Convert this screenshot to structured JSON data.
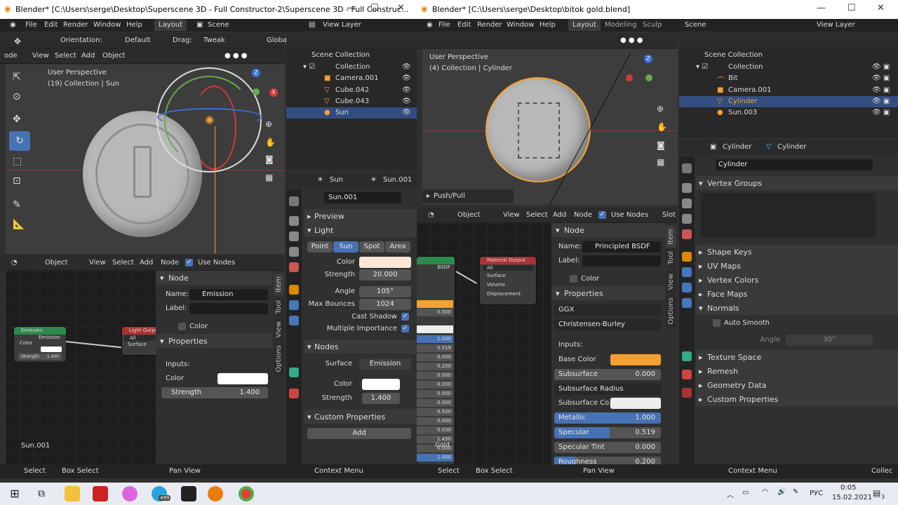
{
  "left": {
    "title": "Blender* [C:\\Users\\serge\\Desktop\\Superscene 3D - Full Constructor-2\\Superscene 3D - Full Construc...",
    "menu": [
      "File",
      "Edit",
      "Render",
      "Window",
      "Help"
    ],
    "workspace": "Layout",
    "scene": "Scene",
    "view_layer": "View Layer",
    "toolbar": {
      "orientation_label": "Orientation:",
      "orientation": "Default",
      "drag_label": "Drag:",
      "drag": "Tweak",
      "transform": "Globa"
    },
    "viewport_menu": [
      "View",
      "Select",
      "Add",
      "Object"
    ],
    "viewport_mode": "ode",
    "viewport_info": [
      "User Perspective",
      "(19) Collection | Sun"
    ],
    "outliner": {
      "root": "Scene Collection",
      "items": [
        {
          "name": "Collection"
        },
        {
          "name": "Camera.001"
        },
        {
          "name": "Cube.042"
        },
        {
          "name": "Cube.043"
        },
        {
          "name": "Sun"
        }
      ]
    },
    "properties": {
      "object_name": "Sun",
      "data_name": "Sun.001",
      "data_field": "Sun.001",
      "preview": "Preview",
      "light": "Light",
      "light_types": [
        "Point",
        "Sun",
        "Spot",
        "Area"
      ],
      "color_label": "Color",
      "strength_label": "Strength",
      "strength": "20.000",
      "angle_label": "Angle",
      "angle": "105°",
      "bounces_label": "Max Bounces",
      "bounces": "1024",
      "cast_shadow": "Cast Shadow",
      "multiple_importance": "Multiple Importance",
      "nodes": "Nodes",
      "surface_label": "Surface",
      "surface": "Emission",
      "ncolor_label": "Color",
      "nstrength_label": "Strength",
      "nstrength": "1.400",
      "custom_props": "Custom Properties",
      "add": "Add"
    },
    "node_editor": {
      "mode": "Object",
      "menu": [
        "View",
        "Select",
        "Add",
        "Node"
      ],
      "use_nodes": "Use Nodes",
      "frame_label": "Sun.001",
      "emission_node": {
        "title": "Emission",
        "out": "Emission",
        "color": "Color",
        "strength": "Strength",
        "strength_val": "1.400"
      },
      "light_output_node": {
        "title": "Light Output",
        "target": "All",
        "surface": "Surface"
      }
    },
    "sidebar": {
      "node": "Node",
      "name_label": "Name:",
      "name": "Emission",
      "label_label": "Label:",
      "color": "Color",
      "properties": "Properties",
      "inputs": "Inputs:",
      "in_color": "Color",
      "in_strength": "Strength",
      "in_strength_val": "1.400",
      "tabs": [
        "Item",
        "Tool",
        "View",
        "Options"
      ]
    },
    "status": [
      "Select",
      "Box Select",
      "Pan View",
      "Context Menu"
    ]
  },
  "right": {
    "title": "Blender* [C:\\Users\\serge\\Desktop\\bitok gold.blend]",
    "menu": [
      "File",
      "Edit",
      "Render",
      "Window",
      "Help"
    ],
    "workspaces": [
      "Layout",
      "Modeling",
      "Sculp"
    ],
    "scene": "Scene",
    "view_layer": "View Layer",
    "viewport_info": [
      "User Perspective",
      "(4) Collection | Cylinder"
    ],
    "operator": "Push/Pull",
    "outliner": {
      "root": "Scene Collection",
      "items": [
        {
          "name": "Collection"
        },
        {
          "name": "Bit"
        },
        {
          "name": "Camera.001"
        },
        {
          "name": "Cylinder"
        },
        {
          "name": "Sun.003"
        }
      ]
    },
    "properties": {
      "object": "Cylinder",
      "mesh": "Cylinder",
      "mesh_field": "Cylinder",
      "sections": [
        "Vertex Groups",
        "Shape Keys",
        "UV Maps",
        "Vertex Colors",
        "Face Maps",
        "Normals"
      ],
      "auto_smooth": "Auto Smooth",
      "angle_label": "Angle",
      "angle": "30°",
      "sections2": [
        "Texture Space",
        "Remesh",
        "Geometry Data",
        "Custom Properties"
      ]
    },
    "node_editor": {
      "mode": "Object",
      "menu": [
        "View",
        "Select",
        "Add",
        "Node"
      ],
      "use_nodes": "Use Nodes",
      "slot": "Slot",
      "material_output": {
        "title": "Material Output",
        "target": "All",
        "surface": "Surface",
        "volume": "Volume",
        "displacement": "Displacement"
      },
      "bsdf_label": "BSDF",
      "slot_values": [
        "0.000",
        "1.000",
        "0.519",
        "0.000",
        "0.200",
        "0.000",
        "0.000",
        "0.000",
        "0.000",
        "0.500",
        "0.000",
        "0.030",
        "1.450",
        "0.000",
        "1.000"
      ],
      "frame_label": "Gold"
    },
    "sidebar": {
      "node": "Node",
      "name_label": "Name:",
      "name": "Principled BSDF",
      "label_label": "Label:",
      "color": "Color",
      "properties": "Properties",
      "distribution": "GGX",
      "subsurface_method": "Christensen-Burley",
      "inputs": "Inputs:",
      "base_color": "Base Color",
      "subsurface": "Subsurface",
      "subsurface_val": "0.000",
      "subsurface_radius": "Subsurface Radius",
      "subsurface_color": "Subsurface Co..",
      "metallic": "Metallic",
      "metallic_val": "1.000",
      "specular": "Specular",
      "specular_val": "0.519",
      "specular_tint": "Specular Tint",
      "specular_tint_val": "0.000",
      "roughness": "Roughness",
      "roughness_val": "0.200",
      "tabs": [
        "Item",
        "Tool",
        "View",
        "Options"
      ]
    },
    "status": [
      "Select",
      "Box Select",
      "Pan View",
      "Context Menu",
      "Collec"
    ]
  },
  "taskbar": {
    "time": "0:05",
    "date": "15.02.2021",
    "lang": "РУС",
    "notif": "3",
    "badge": "499"
  },
  "colors": {
    "accent": "#4772b3",
    "orange": "#f5a030",
    "selected_row": "#334d80",
    "taskbar": "#e8ecf2"
  }
}
